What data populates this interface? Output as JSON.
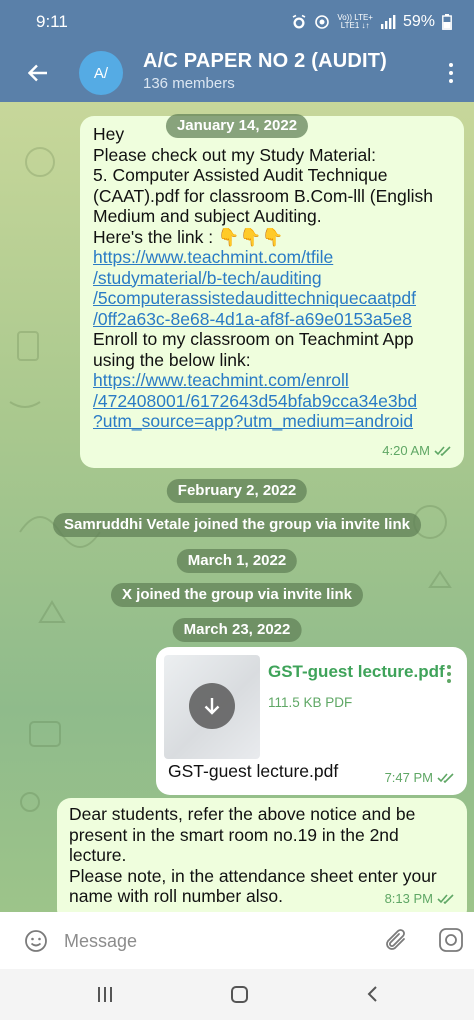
{
  "status_bar": {
    "time": "9:11",
    "network_line1": "Vo)) LTE+",
    "network_line2": "LTE1 ↓↑",
    "battery": "59%"
  },
  "header": {
    "avatar_initials": "A/",
    "title": "A/C PAPER NO 2 (AUDIT)",
    "subtitle": "136 members",
    "colors": {
      "header_bg": "#5a80a9",
      "avatar_bg": "#55abe4"
    }
  },
  "chat": {
    "date_pills": {
      "jan14": "January 14, 2022",
      "feb2": "February 2, 2022",
      "mar1": "March 1, 2022",
      "mar23": "March 23, 2022"
    },
    "service": {
      "samruddhi": "Samruddhi Vetale joined the group via invite link",
      "x_joined": "X joined the group via invite link"
    },
    "message1": {
      "lines": [
        "Hey",
        "Please check out my Study Material:",
        "5. Computer Assisted Audit Technique",
        "(CAAT).pdf for classroom B.Com-lll (English",
        "Medium and subject Auditing.",
        "Here's the link : 👇👇👇"
      ],
      "link1_lines": [
        "https://www.teachmint.com/tfile",
        "/studymaterial/b-tech/auditing",
        "/5computerassistedaudittechniquecaatpdf",
        "/0ff2a63c-8e68-4d1a-af8f-a69e0153a5e8"
      ],
      "after_lines": [
        "Enroll to my classroom on Teachmint App",
        "using the below link:"
      ],
      "link2_lines": [
        "https://www.teachmint.com/enroll",
        "/472408001/6172643d54bfab9cca34e3bd",
        "?utm_source=app?utm_medium=android"
      ],
      "time": "4:20 AM"
    },
    "file_message": {
      "file_name": "GST-guest lecture.pdf",
      "file_size": "111.5 KB PDF",
      "caption": "GST-guest lecture.pdf",
      "time": "7:47 PM"
    },
    "message3": {
      "lines": [
        "Dear students, refer the above notice and be",
        "present in the smart room no.19 in the 2nd",
        "lecture.",
        "Please note, in the attendance sheet enter your",
        "name with roll number also."
      ],
      "time": "8:13 PM"
    }
  },
  "input": {
    "placeholder": "Message"
  },
  "icons": {
    "back": "arrow-left-icon",
    "menu": "more-vertical-icon",
    "emoji": "smile-icon",
    "attach": "paperclip-icon",
    "camera": "camera-icon",
    "download": "download-icon"
  }
}
